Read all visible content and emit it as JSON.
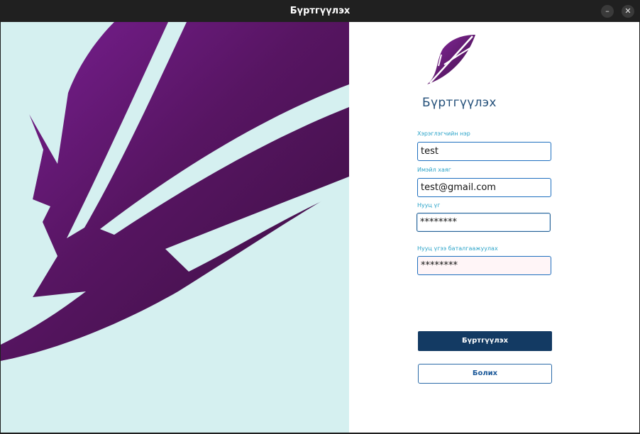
{
  "window": {
    "title": "Бүртгүүлэх",
    "minimize_glyph": "–",
    "close_glyph": "✕"
  },
  "art": {
    "icon": "feather-illustration",
    "background_color": "#d5f0f0",
    "feather_color": "#5a1a63"
  },
  "logo": {
    "icon": "feather-logo-icon"
  },
  "form": {
    "heading": "Бүртгүүлэх",
    "username_label": "Хэрэглэгчийн нэр",
    "username_value": "test",
    "email_label": "Имэйл хаяг",
    "email_value": "test@gmail.com",
    "password_label": "Нууц үг",
    "password_value": "********",
    "confirm_label": "Нууц үгээ баталгаажуулах",
    "confirm_value": "********",
    "register_button": "Бүртгүүлэх",
    "cancel_button": "Болих"
  },
  "colors": {
    "primary": "#133a63",
    "label": "#2aa3c8",
    "heading": "#24507a"
  }
}
